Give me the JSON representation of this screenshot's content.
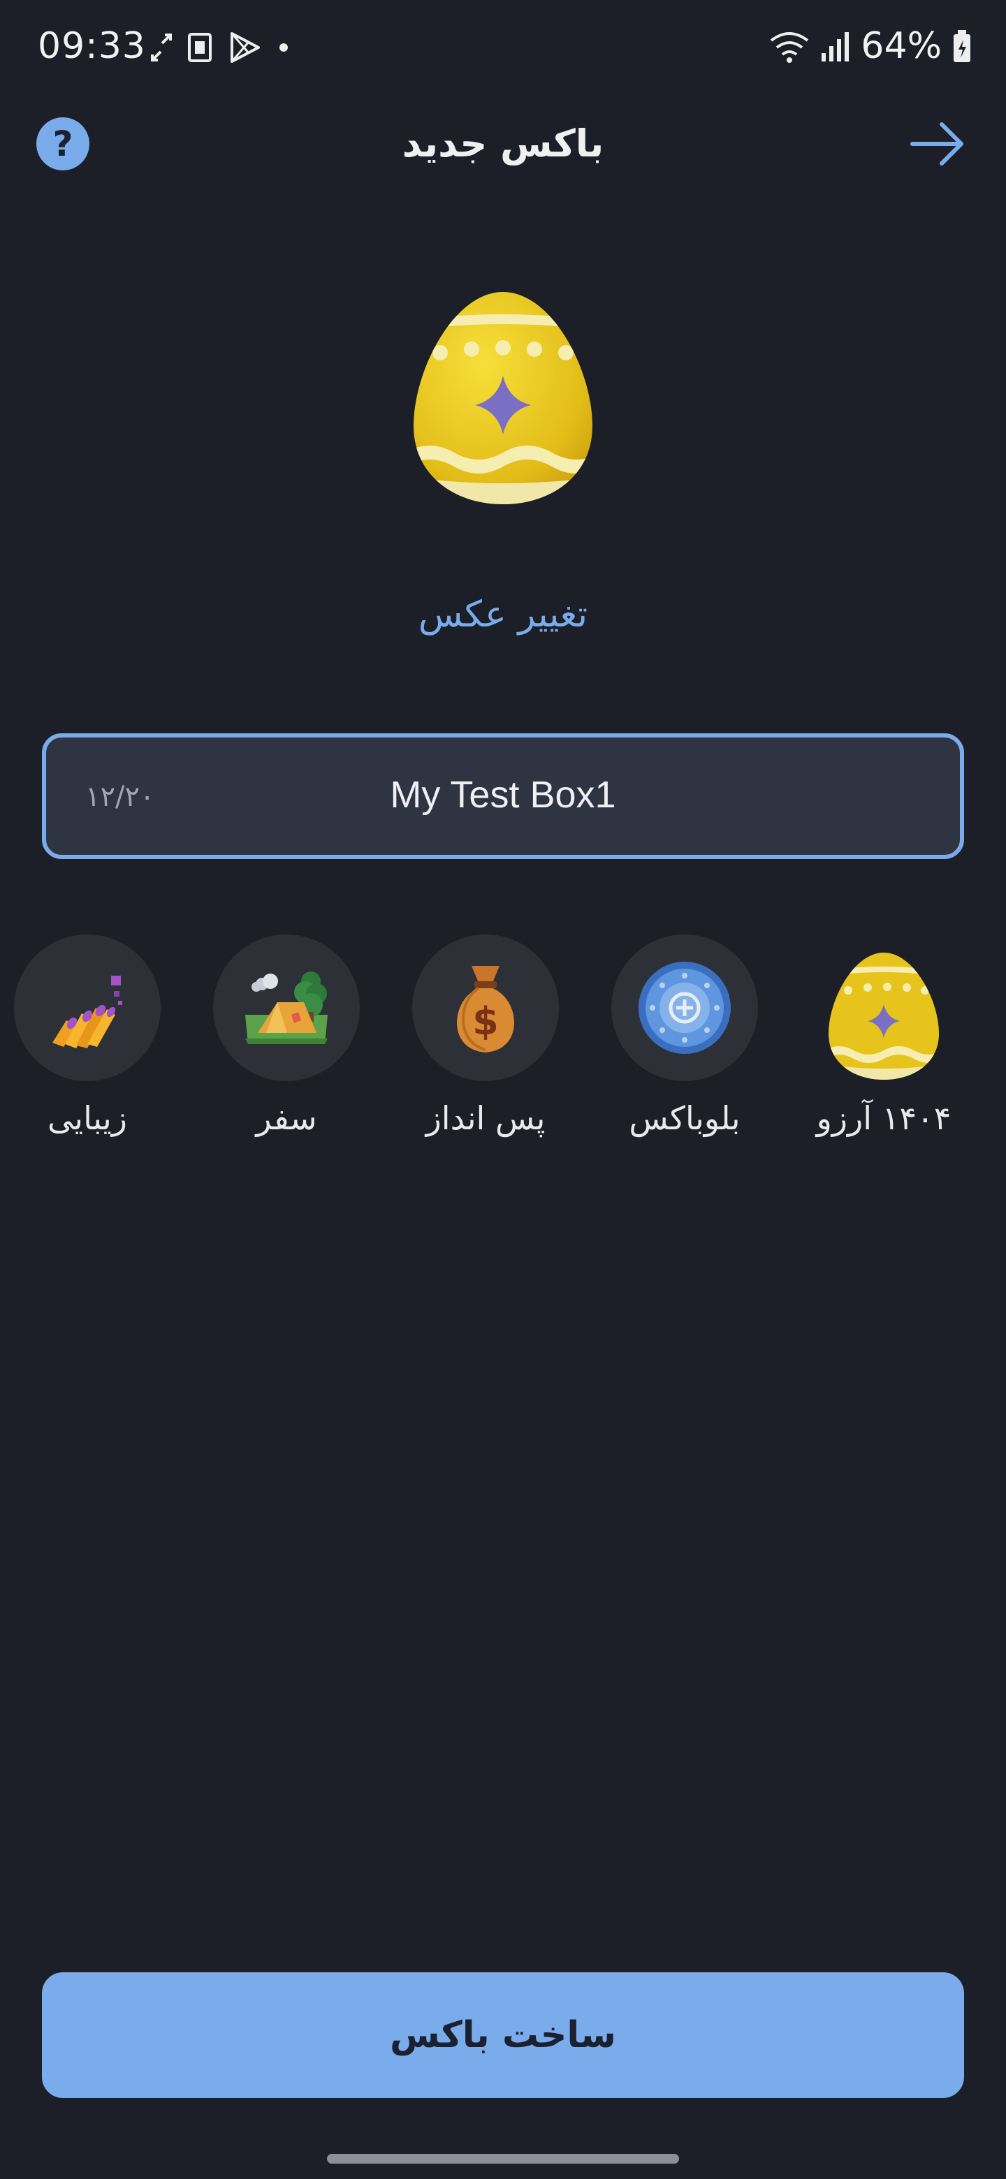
{
  "status_bar": {
    "time": "09:33",
    "battery": "64%",
    "icons": [
      "sync-icon",
      "sim-card-icon",
      "play-store-icon",
      "dot-icon",
      "wifi-icon",
      "signal-icon",
      "battery-icon"
    ]
  },
  "header": {
    "title": "باکس جدید",
    "help_icon": "help-icon",
    "forward_icon": "arrow-right-icon"
  },
  "hero": {
    "image": "easter-egg",
    "change_photo_label": "تغییر عکس"
  },
  "name_field": {
    "value": "My Test Box1",
    "counter": "۱۲/۲۰"
  },
  "categories": [
    {
      "label": "۱۴۰۴ آرزو",
      "icon": "easter-egg-icon"
    },
    {
      "label": "بلوباکس",
      "icon": "blue-box-coin-icon"
    },
    {
      "label": "پس انداز",
      "icon": "money-bag-icon"
    },
    {
      "label": "سفر",
      "icon": "camping-tent-icon"
    },
    {
      "label": "زیبایی",
      "icon": "nail-polish-icon"
    }
  ],
  "create_button_label": "ساخت باکس",
  "colors": {
    "background": "#1c1f27",
    "accent": "#7aabea",
    "field_background": "#2e3442",
    "category_circle": "#2e3038"
  }
}
